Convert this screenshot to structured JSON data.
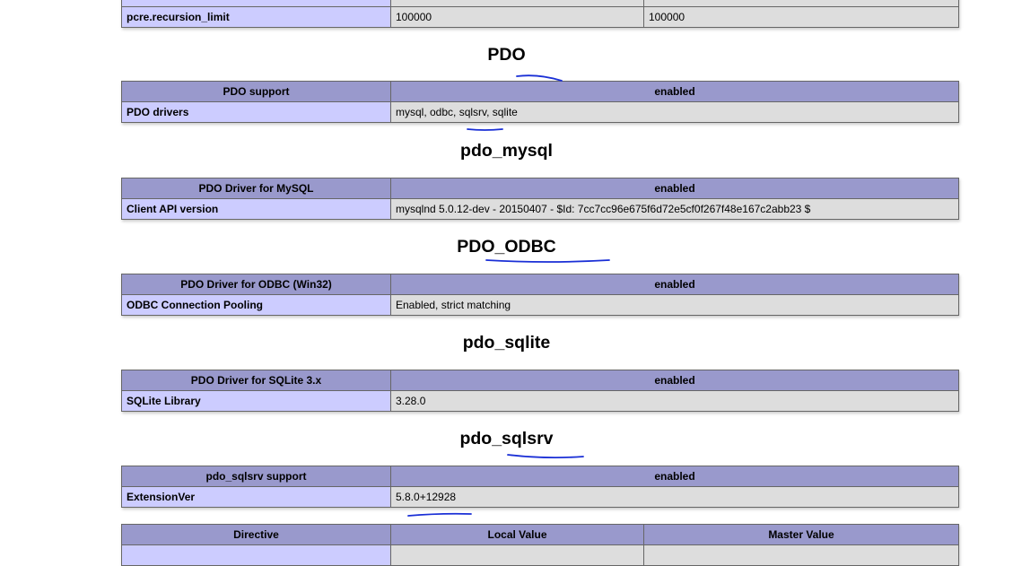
{
  "top_row": {
    "directive": "pcre.recursion_limit",
    "local_value": "100000",
    "master_value": "100000"
  },
  "sections": [
    {
      "title": "PDO",
      "header_key": "PDO support",
      "header_value": "enabled",
      "rows": [
        {
          "key": "PDO drivers",
          "value": "mysql, odbc, sqlsrv, sqlite"
        }
      ]
    },
    {
      "title": "pdo_mysql",
      "header_key": "PDO Driver for MySQL",
      "header_value": "enabled",
      "rows": [
        {
          "key": "Client API version",
          "value": "mysqlnd 5.0.12-dev - 20150407 - $Id: 7cc7cc96e675f6d72e5cf0f267f48e167c2abb23 $"
        }
      ]
    },
    {
      "title": "PDO_ODBC",
      "header_key": "PDO Driver for ODBC (Win32)",
      "header_value": "enabled",
      "rows": [
        {
          "key": "ODBC Connection Pooling",
          "value": "Enabled, strict matching"
        }
      ]
    },
    {
      "title": "pdo_sqlite",
      "header_key": "PDO Driver for SQLite 3.x",
      "header_value": "enabled",
      "rows": [
        {
          "key": "SQLite Library",
          "value": "3.28.0"
        }
      ]
    },
    {
      "title": "pdo_sqlsrv",
      "header_key": "pdo_sqlsrv support",
      "header_value": "enabled",
      "rows": [
        {
          "key": "ExtensionVer",
          "value": "5.8.0+12928"
        }
      ]
    }
  ],
  "directive_header": {
    "directive": "Directive",
    "local_value": "Local Value",
    "master_value": "Master Value"
  },
  "annotation_color": "#1a2fd6"
}
